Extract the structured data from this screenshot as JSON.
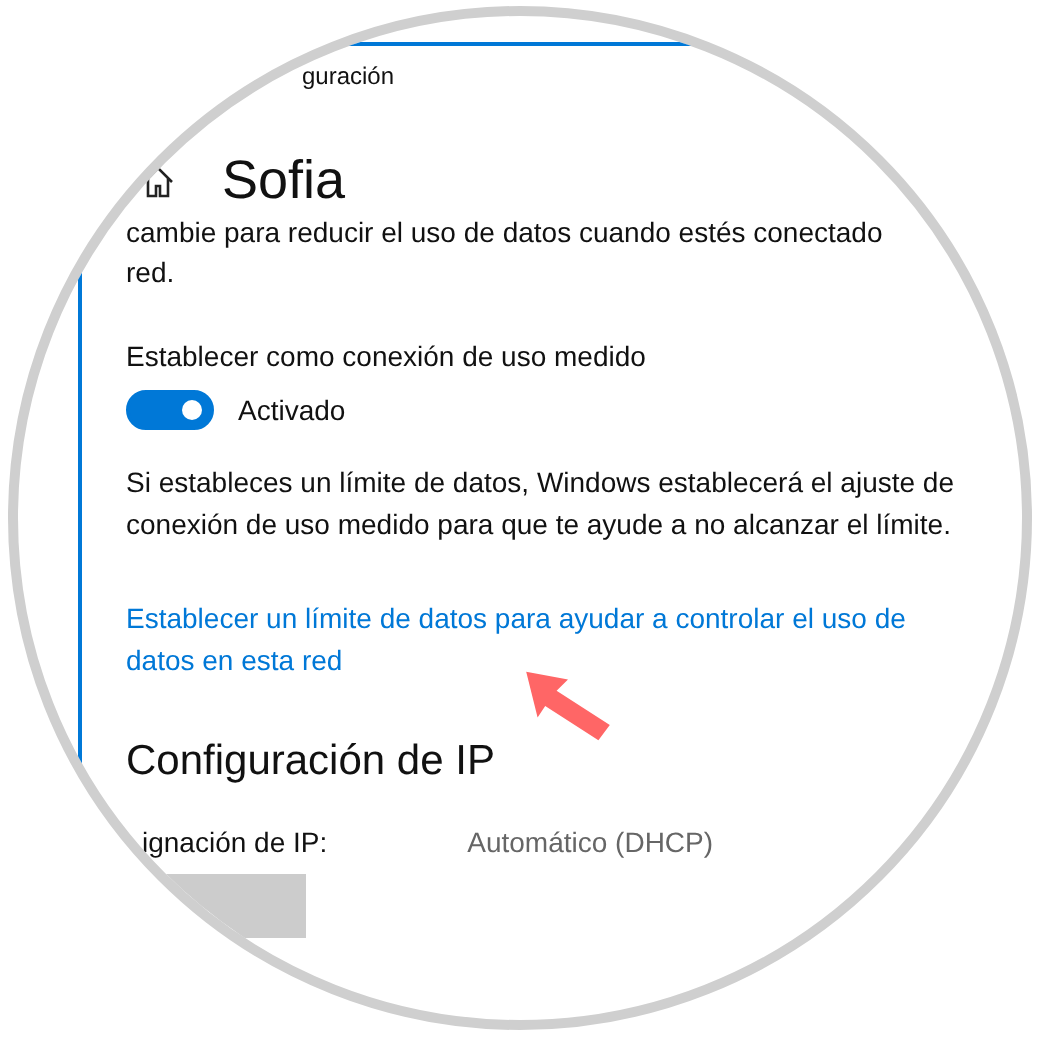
{
  "breadcrumb": "guración",
  "page_title": "Sofia",
  "description_lines": [
    "cambie para reducir el uso de datos cuando estés conectado",
    "red."
  ],
  "metered": {
    "label": "Establecer como conexión de uso medido",
    "on": true,
    "state_label": "Activado"
  },
  "info": "Si estableces un límite de datos, Windows establecerá el ajuste de conexión de uso medido para que te ayude a no alcanzar el límite.",
  "link": "Establecer un límite de datos para ayudar a controlar el uso de datos en esta red",
  "ip_section": {
    "title": "Configuración de IP",
    "rows": [
      {
        "label": "ignación de IP:",
        "value": "Automático (DHCP)"
      }
    ]
  }
}
